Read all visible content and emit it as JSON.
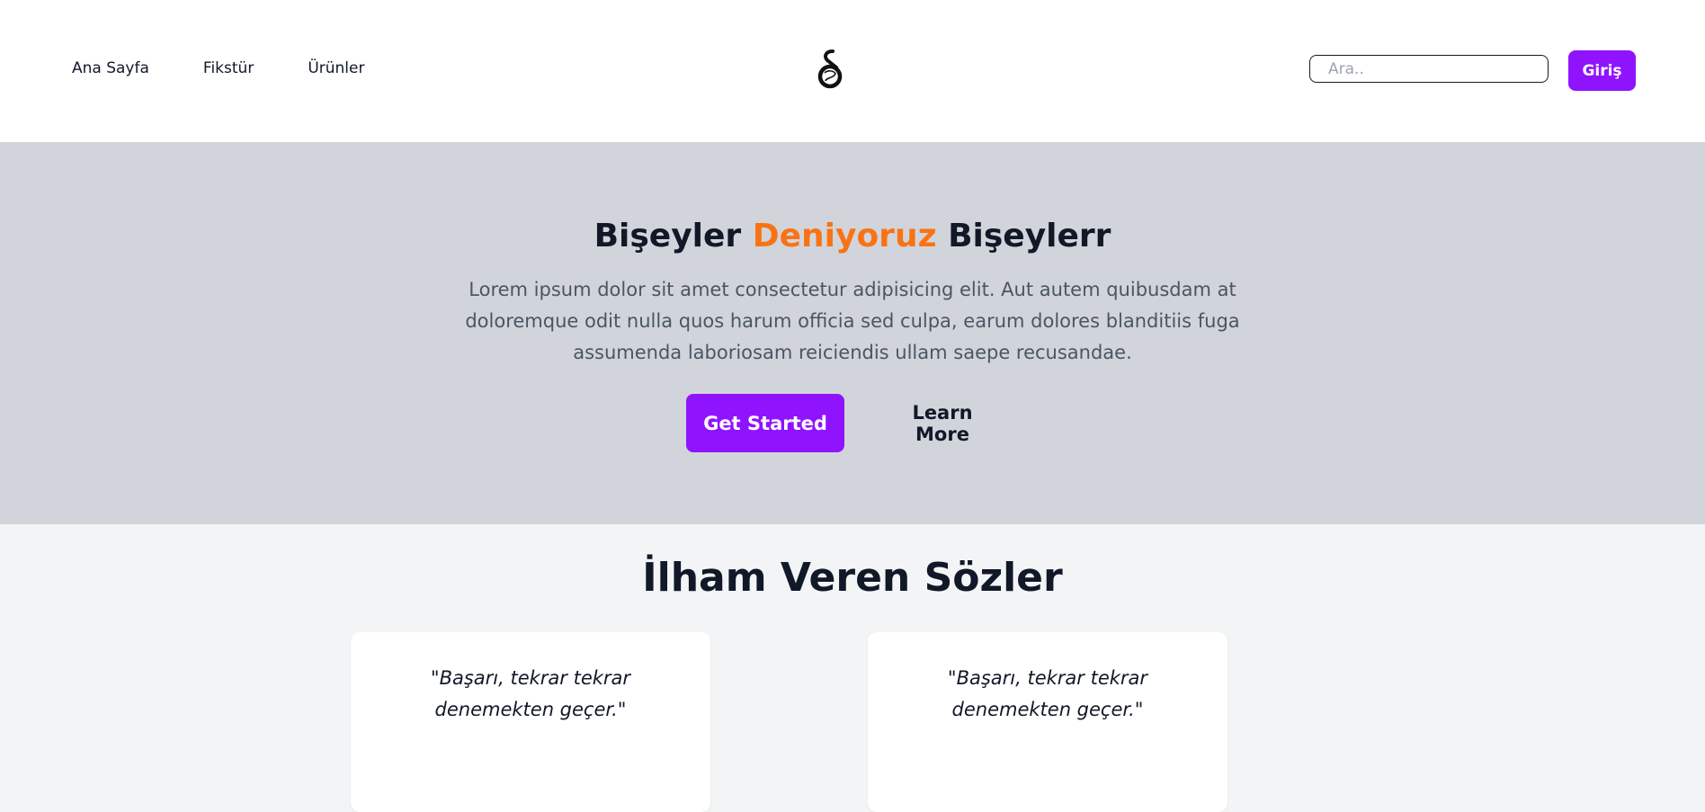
{
  "nav": {
    "links": [
      "Ana Sayfa",
      "Fikstür",
      "Ürünler"
    ],
    "logo_icon": "galatasaray-gs-logo-icon",
    "search_placeholder": "Ara..",
    "login_label": "Giriş"
  },
  "hero": {
    "title_part1": "Bişeyler ",
    "title_accent": "Deniyoruz",
    "title_part2": " Bişeylerr",
    "text": "Lorem ipsum dolor sit amet consectetur adipisicing elit. Aut autem quibusdam at doloremque odit nulla quos harum officia sed culpa, earum dolores blanditiis fuga assumenda laboriosam reiciendis ullam saepe recusandae.",
    "primary_button": "Get Started",
    "secondary_button": "Learn More"
  },
  "quotes": {
    "title": "İlham Veren Sözler",
    "items": [
      "\"Başarı, tekrar tekrar denemekten geçer.\"",
      "\"Başarı, tekrar tekrar denemekten geçer.\""
    ]
  },
  "colors": {
    "accent_purple": "#9013fe",
    "accent_orange": "#f97316",
    "hero_bg": "#d1d5db",
    "page_bg": "#f3f4f6"
  }
}
